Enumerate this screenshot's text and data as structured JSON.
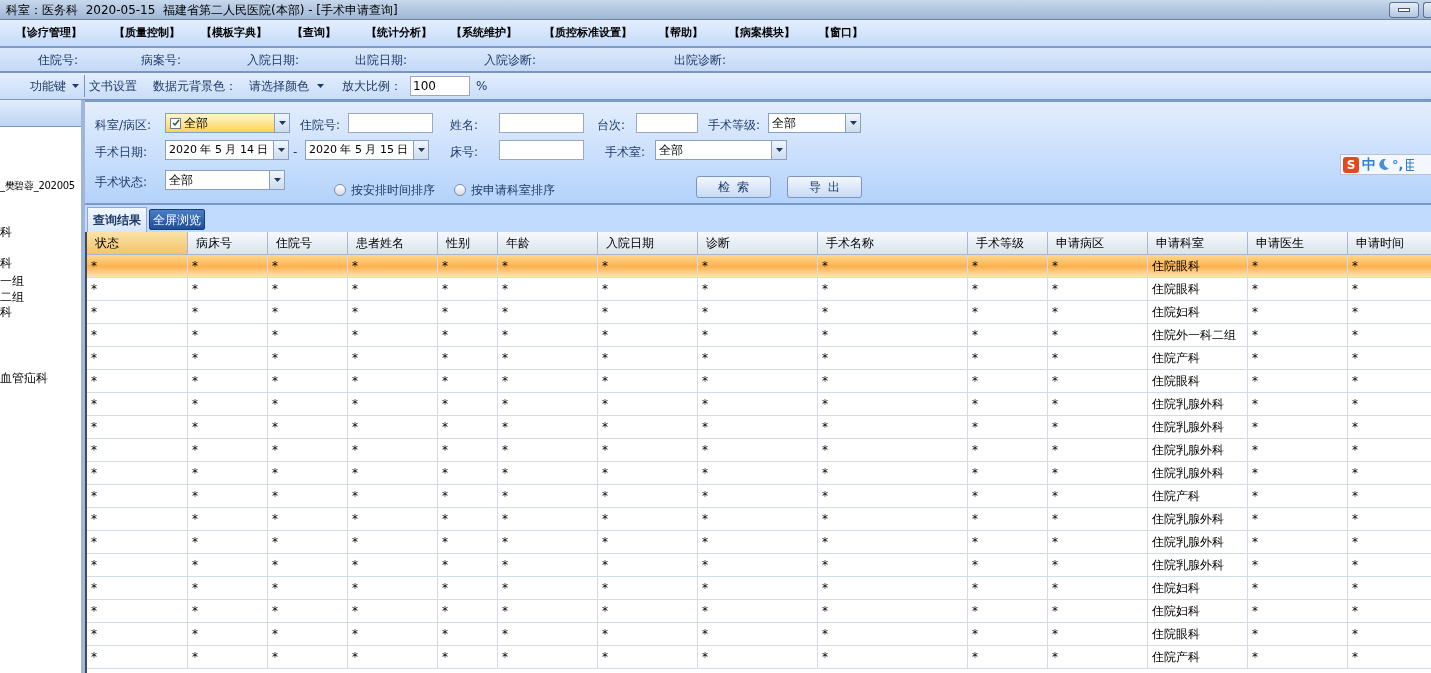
{
  "window": {
    "title": "科室：医务科  2020-05-15  福建省第二人民医院(本部) - [手术申请查询]"
  },
  "menu": [
    "【诊疗管理】",
    "【质量控制】",
    "【模板字典】",
    "【查询】",
    "【统计分析】",
    "【系统维护】",
    "【质控标准设置】",
    "【帮助】",
    "【病案模块】",
    "【窗口】"
  ],
  "patient_bar": [
    "住院号:",
    "病案号:",
    "入院日期:",
    "出院日期:",
    "入院诊断:",
    "出院诊断:"
  ],
  "toolbar": {
    "function_key": "功能键",
    "doc_settings": "文书设置",
    "bg_label": "数据元背景色：",
    "bg_select": "请选择颜色",
    "zoom_label": "放大比例：",
    "zoom_value": "100",
    "zoom_unit": "%"
  },
  "sidebar": {
    "items": [
      "_樊碧蓉_202005",
      "科",
      "科",
      "一组",
      "二组",
      "科",
      "血管疝科"
    ]
  },
  "filters": {
    "dept_label": "科室/病区:",
    "dept_value": "全部",
    "dept_checked": true,
    "inpatient_label": "住院号:",
    "name_label": "姓名:",
    "table_label": "台次:",
    "grade_label": "手术等级:",
    "grade_value": "全部",
    "date_label": "手术日期:",
    "date_from": "2020 年 5 月 14 日",
    "date_sep": "-",
    "date_to": "2020 年 5 月 15 日",
    "bed_label": "床号:",
    "room_label": "手术室:",
    "room_value": "全部",
    "status_label": "手术状态:",
    "status_value": "全部",
    "sort_options": [
      {
        "label": "按安排时间排序",
        "selected": false
      },
      {
        "label": "按申请科室排序",
        "selected": false
      }
    ],
    "buttons": [
      "检  索",
      "导  出"
    ]
  },
  "ime": {
    "logo": "S",
    "mode": "中",
    "punct": "°,"
  },
  "tabs": [
    {
      "label": "查询结果",
      "selected": true
    },
    {
      "label": "全屏浏览",
      "selected": false
    }
  ],
  "table": {
    "columns": [
      "状态",
      "病床号",
      "住院号",
      "患者姓名",
      "性别",
      "年龄",
      "入院日期",
      "诊断",
      "手术名称",
      "手术等级",
      "申请病区",
      "申请科室",
      "申请医生",
      "申请时间"
    ],
    "rows": [
      {
        "selected": true,
        "cells": [
          "*",
          "*",
          "*",
          "*",
          "*",
          "*",
          "*",
          "*",
          "*",
          "*",
          "*",
          "住院眼科",
          "*",
          "*"
        ]
      },
      {
        "selected": false,
        "cells": [
          "*",
          "*",
          "*",
          "*",
          "*",
          "*",
          "*",
          "*",
          "*",
          "*",
          "*",
          "住院眼科",
          "*",
          "*"
        ]
      },
      {
        "selected": false,
        "cells": [
          "*",
          "*",
          "*",
          "*",
          "*",
          "*",
          "*",
          "*",
          "*",
          "*",
          "*",
          "住院妇科",
          "*",
          "*"
        ]
      },
      {
        "selected": false,
        "cells": [
          "*",
          "*",
          "*",
          "*",
          "*",
          "*",
          "*",
          "*",
          "*",
          "*",
          "*",
          "住院外一科二组",
          "*",
          "*"
        ]
      },
      {
        "selected": false,
        "cells": [
          "*",
          "*",
          "*",
          "*",
          "*",
          "*",
          "*",
          "*",
          "*",
          "*",
          "*",
          "住院产科",
          "*",
          "*"
        ]
      },
      {
        "selected": false,
        "cells": [
          "*",
          "*",
          "*",
          "*",
          "*",
          "*",
          "*",
          "*",
          "*",
          "*",
          "*",
          "住院眼科",
          "*",
          "*"
        ]
      },
      {
        "selected": false,
        "cells": [
          "*",
          "*",
          "*",
          "*",
          "*",
          "*",
          "*",
          "*",
          "*",
          "*",
          "*",
          "住院乳腺外科",
          "*",
          "*"
        ]
      },
      {
        "selected": false,
        "cells": [
          "*",
          "*",
          "*",
          "*",
          "*",
          "*",
          "*",
          "*",
          "*",
          "*",
          "*",
          "住院乳腺外科",
          "*",
          "*"
        ]
      },
      {
        "selected": false,
        "cells": [
          "*",
          "*",
          "*",
          "*",
          "*",
          "*",
          "*",
          "*",
          "*",
          "*",
          "*",
          "住院乳腺外科",
          "*",
          "*"
        ]
      },
      {
        "selected": false,
        "cells": [
          "*",
          "*",
          "*",
          "*",
          "*",
          "*",
          "*",
          "*",
          "*",
          "*",
          "*",
          "住院乳腺外科",
          "*",
          "*"
        ]
      },
      {
        "selected": false,
        "cells": [
          "*",
          "*",
          "*",
          "*",
          "*",
          "*",
          "*",
          "*",
          "*",
          "*",
          "*",
          "住院产科",
          "*",
          "*"
        ]
      },
      {
        "selected": false,
        "cells": [
          "*",
          "*",
          "*",
          "*",
          "*",
          "*",
          "*",
          "*",
          "*",
          "*",
          "*",
          "住院乳腺外科",
          "*",
          "*"
        ]
      },
      {
        "selected": false,
        "cells": [
          "*",
          "*",
          "*",
          "*",
          "*",
          "*",
          "*",
          "*",
          "*",
          "*",
          "*",
          "住院乳腺外科",
          "*",
          "*"
        ]
      },
      {
        "selected": false,
        "cells": [
          "*",
          "*",
          "*",
          "*",
          "*",
          "*",
          "*",
          "*",
          "*",
          "*",
          "*",
          "住院乳腺外科",
          "*",
          "*"
        ]
      },
      {
        "selected": false,
        "cells": [
          "*",
          "*",
          "*",
          "*",
          "*",
          "*",
          "*",
          "*",
          "*",
          "*",
          "*",
          "住院妇科",
          "*",
          "*"
        ]
      },
      {
        "selected": false,
        "cells": [
          "*",
          "*",
          "*",
          "*",
          "*",
          "*",
          "*",
          "*",
          "*",
          "*",
          "*",
          "住院妇科",
          "*",
          "*"
        ]
      },
      {
        "selected": false,
        "cells": [
          "*",
          "*",
          "*",
          "*",
          "*",
          "*",
          "*",
          "*",
          "*",
          "*",
          "*",
          "住院眼科",
          "*",
          "*"
        ]
      },
      {
        "selected": false,
        "cells": [
          "*",
          "*",
          "*",
          "*",
          "*",
          "*",
          "*",
          "*",
          "*",
          "*",
          "*",
          "住院产科",
          "*",
          "*"
        ]
      }
    ]
  }
}
